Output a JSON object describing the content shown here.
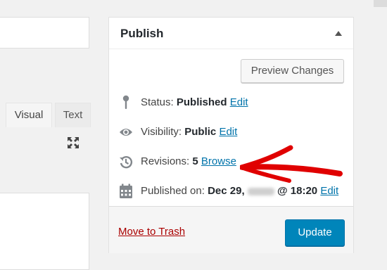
{
  "editor": {
    "tabs": [
      "Visual",
      "Text"
    ],
    "fullscreen_icon": "fullscreen-icon"
  },
  "publish_box": {
    "title": "Publish",
    "collapse_icon": "triangle-up-icon",
    "preview_button": "Preview Changes",
    "status": {
      "label": "Status:",
      "value": "Published",
      "link": "Edit",
      "icon": "pin-icon"
    },
    "visibility": {
      "label": "Visibility:",
      "value": "Public",
      "link": "Edit",
      "icon": "eye-icon"
    },
    "revisions": {
      "label": "Revisions:",
      "value": "5",
      "link": "Browse",
      "icon": "history-icon"
    },
    "published_on": {
      "label": "Published on:",
      "date_prefix": "Dec 29,",
      "time": "@ 18:20",
      "link": "Edit",
      "icon": "calendar-icon"
    },
    "trash_link": "Move to Trash",
    "update_button": "Update"
  },
  "colors": {
    "primary_button": "#0085ba",
    "link": "#0073aa",
    "trash": "#aa0000",
    "annotation_arrow": "#e00000"
  }
}
